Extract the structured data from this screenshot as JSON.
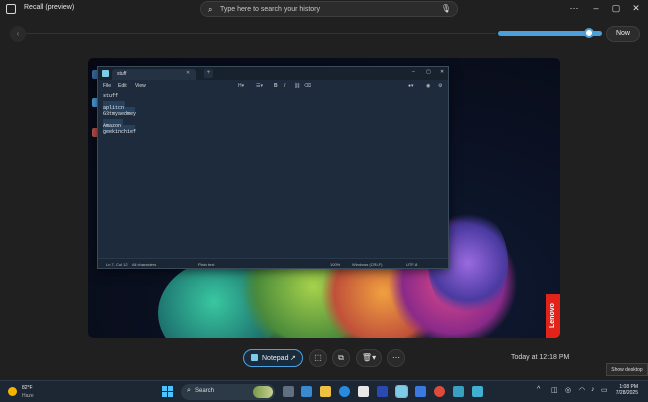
{
  "window": {
    "title": "Recall (preview)"
  },
  "search": {
    "placeholder": "Type here to search your history"
  },
  "timeline": {
    "now_label": "Now",
    "position_fraction": 0.9
  },
  "snapshot": {
    "brand": "Lenovo",
    "notepad": {
      "tab_title": "stuff",
      "menu": [
        "File",
        "Edit",
        "View"
      ],
      "lines": [
        "stuff",
        "",
        "aplitcn",
        "G3tmyaedmey",
        "",
        "Amazon",
        "geekinchief"
      ],
      "status": {
        "position": "Ln 7, Col 12",
        "characters": "All characters",
        "format": "Plain text",
        "zoom": "100%",
        "line_ending": "Windows (CRLF)",
        "encoding": "UTF-8"
      }
    }
  },
  "actions": {
    "app_pill_label": "Notepad",
    "timestamp": "Today at 12:18 PM"
  },
  "tooltip": "Show desktop",
  "taskbar": {
    "weather_temp": "82°F",
    "weather_cond": "Haze",
    "search_label": "Search",
    "time": "1:08 PM",
    "date": "7/28/2025"
  },
  "colors": {
    "accent": "#4c9fd8",
    "background": "#202020",
    "lenovo": "#e2231a"
  }
}
